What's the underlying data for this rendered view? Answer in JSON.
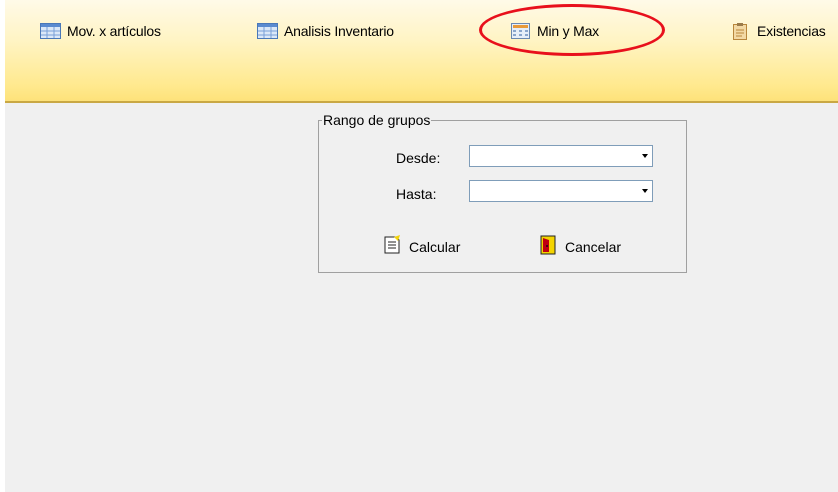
{
  "toolbar": {
    "items": [
      {
        "label": "Mov. x artículos",
        "icon": "grid-table-icon"
      },
      {
        "label": "Analisis Inventario",
        "icon": "grid-table-icon"
      },
      {
        "label": "Min y Max",
        "icon": "calculator-icon"
      },
      {
        "label": "Existencias",
        "icon": "clipboard-icon"
      }
    ]
  },
  "dialog": {
    "group_title": "Rango de grupos",
    "desde_label": "Desde:",
    "desde_value": "",
    "hasta_label": "Hasta:",
    "hasta_value": "",
    "calcular_label": "Calcular",
    "cancelar_label": "Cancelar"
  },
  "colors": {
    "toolbar_top": "#fffae8",
    "toolbar_bottom": "#fde27a",
    "content_bg": "#f0f0f0",
    "highlight": "#e8101c"
  }
}
